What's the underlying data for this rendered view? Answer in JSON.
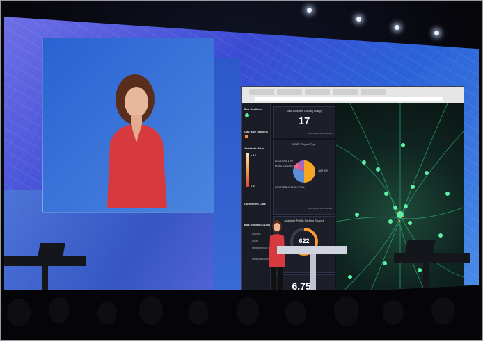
{
  "dashboard": {
    "sidebar": {
      "bus_positions": "Bus Positions",
      "city_bike_stations": "City Bike Stations",
      "available_bikes": "Available Bikes",
      "available_bikes_max": "> 14",
      "available_bikes_min": "< 2",
      "connected_cars": "Connected Cars",
      "bus_routes": "Bus Routes (CNTS)",
      "route_express": "Express",
      "route_local": "Local",
      "route_neighborhood": "Neighborhood Shuttle",
      "route_regional": "Regional Express"
    },
    "accident_card": {
      "title": "New Accident Count (Today)",
      "value": "17",
      "footer": "Last update: a minute ago"
    },
    "waze_card": {
      "title": "WAZE Report Type",
      "slice_accident": "ACCIDENT 12%",
      "slice_road_closed": "ROAD_CLOSED 7%",
      "slice_jam": "JAM 50%",
      "slice_weatherhazard": "WEATHERHAZARD 30.6%",
      "footer": "Last update: a minute ago",
      "slices": [
        {
          "label": "JAM",
          "value": 50,
          "color": "#f5a623"
        },
        {
          "label": "WEATHERHAZARD",
          "value": 30.6,
          "color": "#5b8fd9"
        },
        {
          "label": "ACCIDENT",
          "value": 12,
          "color": "#e05d8a"
        },
        {
          "label": "ROAD_CLOSED",
          "value": 7.4,
          "color": "#9a6bd6"
        }
      ]
    },
    "parking_card": {
      "title": "Available Public Parking Spaces",
      "gauge_value": "622",
      "gauge_fraction": 0.62
    },
    "bottom_value": "6,759",
    "bottom_footer": "Last update: a minute ago",
    "colors": {
      "bus_marker": "#5df0a6",
      "bike_station": "#ff8c3a",
      "gauge": "#ff9a2e"
    }
  }
}
